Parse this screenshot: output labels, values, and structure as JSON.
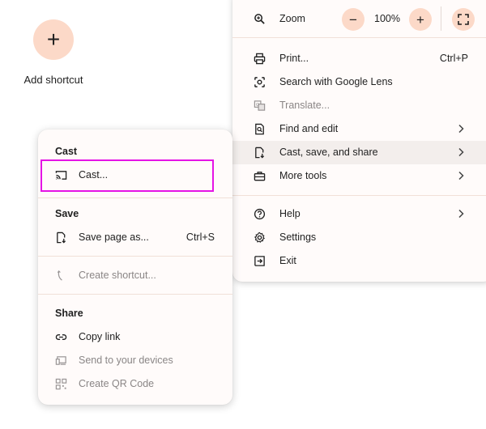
{
  "shortcut": {
    "plus": "+",
    "label": "Add shortcut"
  },
  "main_menu": {
    "zoom": {
      "label": "Zoom",
      "minus": "−",
      "value": "100%",
      "plus": "+"
    },
    "print": {
      "label": "Print...",
      "shortcut": "Ctrl+P"
    },
    "lens": {
      "label": "Search with Google Lens"
    },
    "translate": {
      "label": "Translate..."
    },
    "find": {
      "label": "Find and edit"
    },
    "cast_save_share": {
      "label": "Cast, save, and share"
    },
    "more_tools": {
      "label": "More tools"
    },
    "help": {
      "label": "Help"
    },
    "settings": {
      "label": "Settings"
    },
    "exit": {
      "label": "Exit"
    }
  },
  "sub_menu": {
    "cast_heading": "Cast",
    "cast_item": "Cast...",
    "save_heading": "Save",
    "save_page": {
      "label": "Save page as...",
      "shortcut": "Ctrl+S"
    },
    "create_shortcut": "Create shortcut...",
    "share_heading": "Share",
    "copy_link": "Copy link",
    "send_devices": "Send to your devices",
    "qr_code": "Create QR Code"
  },
  "colors": {
    "accent_tint": "#fcd9c8",
    "highlight_outline": "#e514e5",
    "menu_bg": "#fffbfa"
  }
}
